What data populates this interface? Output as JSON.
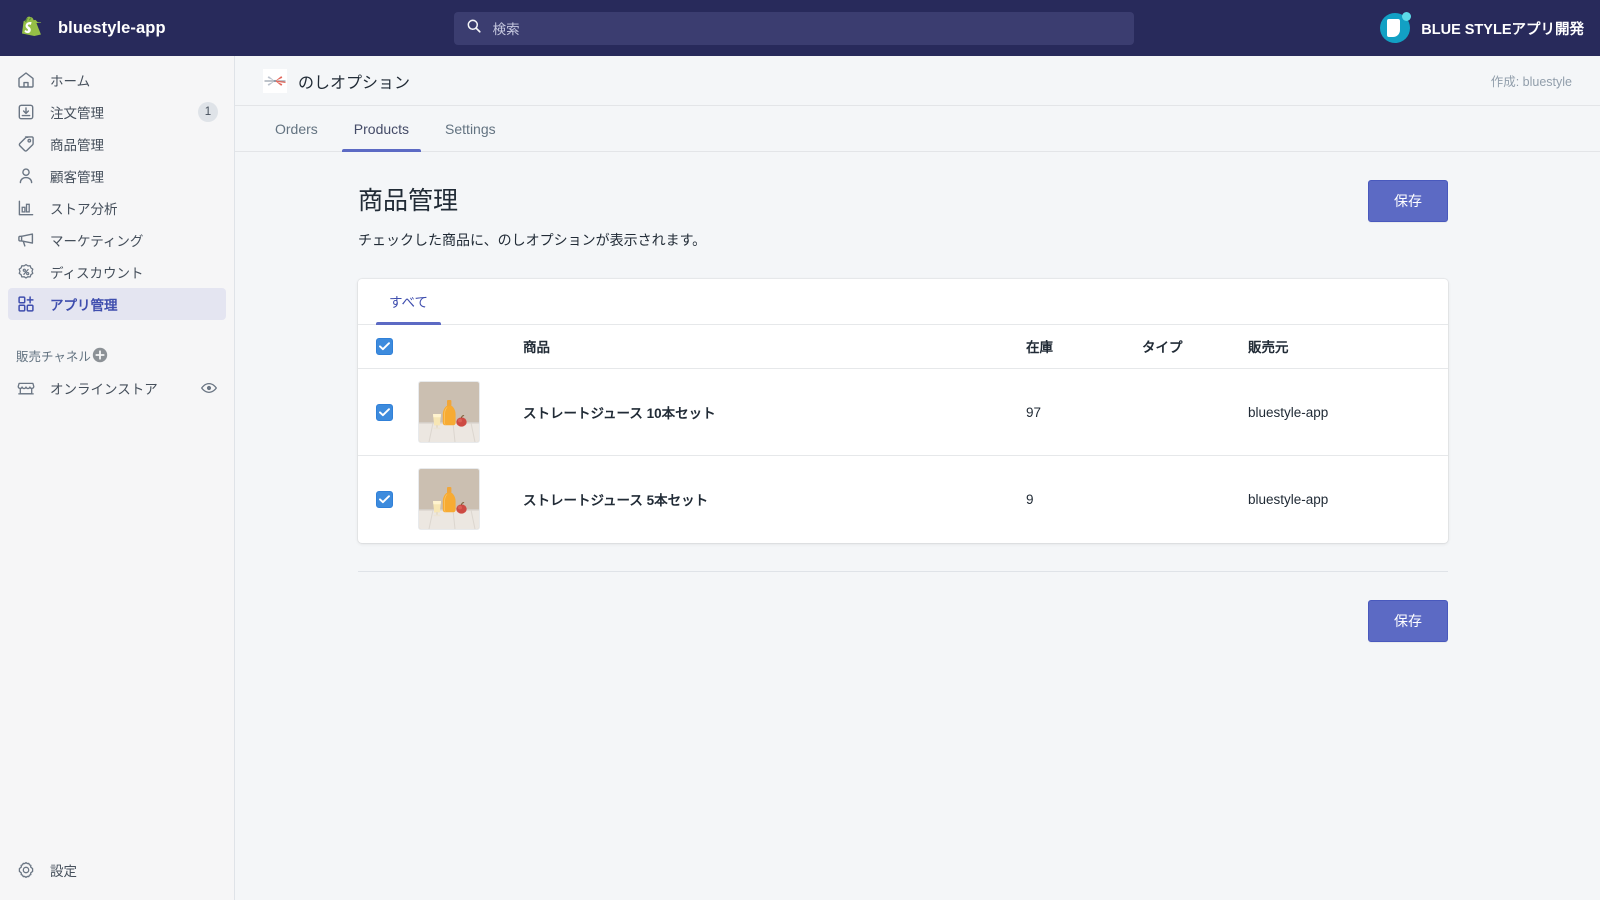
{
  "topbar": {
    "store_name": "bluestyle-app",
    "logo_icon": "shopify-bag-icon",
    "search": {
      "icon": "search-icon",
      "placeholder": "検索",
      "value": ""
    },
    "account": {
      "name": "BLUE STYLEアプリ開発",
      "avatar_icon": "account-avatar-icon"
    },
    "background_color": "#282a5b"
  },
  "sidebar": {
    "items": [
      {
        "label": "ホーム",
        "icon": "home-icon",
        "badge": "",
        "active": false
      },
      {
        "label": "注文管理",
        "icon": "orders-inbox-icon",
        "badge": "1",
        "active": false
      },
      {
        "label": "商品管理",
        "icon": "product-tag-icon",
        "badge": "",
        "active": false
      },
      {
        "label": "顧客管理",
        "icon": "customer-person-icon",
        "badge": "",
        "active": false
      },
      {
        "label": "ストア分析",
        "icon": "analytics-bar-chart-icon",
        "badge": "",
        "active": false
      },
      {
        "label": "マーケティング",
        "icon": "marketing-megaphone-icon",
        "badge": "",
        "active": false
      },
      {
        "label": "ディスカウント",
        "icon": "discount-percent-icon",
        "badge": "",
        "active": false
      },
      {
        "label": "アプリ管理",
        "icon": "apps-grid-plus-icon",
        "badge": "",
        "active": true
      }
    ],
    "channel_section": {
      "label": "販売チャネル",
      "add_icon": "plus-circle-icon",
      "items": [
        {
          "label": "オンラインストア",
          "icon": "storefront-icon",
          "action_icon": "eye-icon"
        }
      ]
    },
    "settings": {
      "label": "設定",
      "icon": "gear-icon"
    },
    "active_color": "#3f4eae"
  },
  "app": {
    "icon": "noshi-ribbon-icon",
    "title": "のしオプション",
    "author": "作成: bluestyle",
    "tabs": [
      {
        "label": "Orders",
        "active": false
      },
      {
        "label": "Products",
        "active": true
      },
      {
        "label": "Settings",
        "active": false
      }
    ]
  },
  "page": {
    "title": "商品管理",
    "subtitle": "チェックした商品に、のしオプションが表示されます。",
    "save_top_label": "保存",
    "save_bottom_label": "保存",
    "accent_color": "#5c6ac4"
  },
  "table": {
    "filter_tabs": [
      {
        "label": "すべて",
        "active": true
      }
    ],
    "select_all_checked": true,
    "columns": [
      "",
      "",
      "商品",
      "在庫",
      "タイプ",
      "販売元"
    ],
    "headers": {
      "product": "商品",
      "stock": "在庫",
      "type": "タイプ",
      "vendor": "販売元"
    },
    "rows": [
      {
        "checked": true,
        "thumbnail_icon": "juice-bottle-photo",
        "name": "ストレートジュース 10本セット",
        "stock": "97",
        "type": "",
        "vendor": "bluestyle-app"
      },
      {
        "checked": true,
        "thumbnail_icon": "juice-bottle-photo",
        "name": "ストレートジュース 5本セット",
        "stock": "9",
        "type": "",
        "vendor": "bluestyle-app"
      }
    ]
  }
}
